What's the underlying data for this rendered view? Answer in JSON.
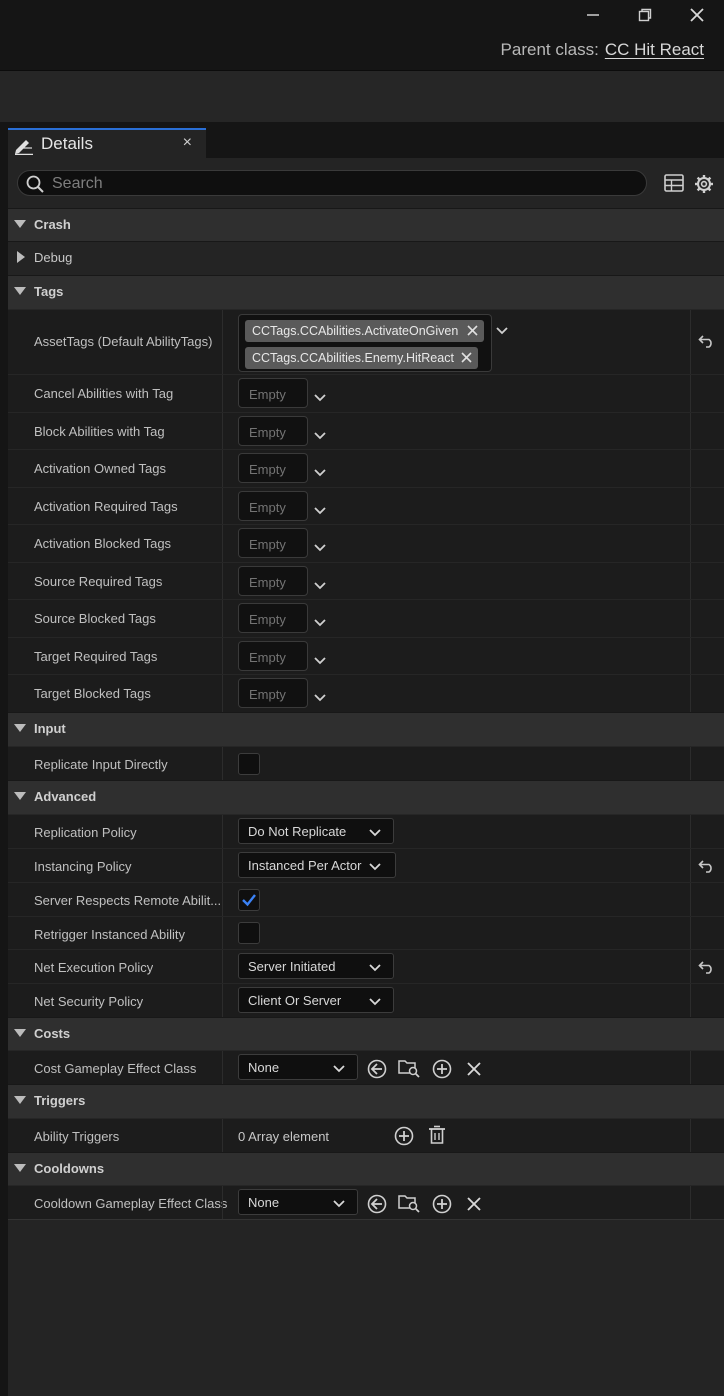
{
  "window": {
    "parent_class_label": "Parent class:",
    "parent_class_value": "CC Hit React",
    "minimize_icon": "minimize-icon",
    "restore_icon": "restore-icon",
    "close_icon": "close-icon"
  },
  "tab": {
    "label": "Details",
    "close": "×"
  },
  "search": {
    "placeholder": "Search"
  },
  "categories": {
    "crash": "Crash",
    "debug": "Debug",
    "tags": "Tags",
    "input": "Input",
    "advanced": "Advanced",
    "costs": "Costs",
    "triggers": "Triggers",
    "cooldowns": "Cooldowns"
  },
  "tags": {
    "asset_tags_label": "AssetTags (Default AbilityTags)",
    "asset_tags": [
      "CCTags.CCAbilities.ActivateOnGiven",
      "CCTags.CCAbilities.Enemy.HitReact"
    ],
    "empty_text": "Empty",
    "rows": [
      "Cancel Abilities with Tag",
      "Block Abilities with Tag",
      "Activation Owned Tags",
      "Activation Required Tags",
      "Activation Blocked Tags",
      "Source Required Tags",
      "Source Blocked Tags",
      "Target Required Tags",
      "Target Blocked Tags"
    ]
  },
  "input": {
    "replicate_label": "Replicate Input Directly",
    "replicate_checked": false
  },
  "advanced": {
    "replication_policy_label": "Replication Policy",
    "replication_policy_value": "Do Not Replicate",
    "instancing_policy_label": "Instancing Policy",
    "instancing_policy_value": "Instanced Per Actor",
    "server_respects_label": "Server Respects Remote Abilit...",
    "server_respects_checked": true,
    "retrigger_label": "Retrigger Instanced Ability",
    "retrigger_checked": false,
    "net_execution_label": "Net Execution Policy",
    "net_execution_value": "Server Initiated",
    "net_security_label": "Net Security Policy",
    "net_security_value": "Client Or Server"
  },
  "costs": {
    "cost_effect_label": "Cost Gameplay Effect Class",
    "cost_effect_value": "None"
  },
  "triggers": {
    "ability_triggers_label": "Ability Triggers",
    "ability_triggers_value": "0 Array element"
  },
  "cooldowns": {
    "cooldown_effect_label": "Cooldown Gameplay Effect Class",
    "cooldown_effect_value": "None"
  },
  "colors": {
    "accent": "#2a6fd6",
    "checkbox_check": "#3b82f6",
    "background": "#151515",
    "panel": "#242424"
  }
}
